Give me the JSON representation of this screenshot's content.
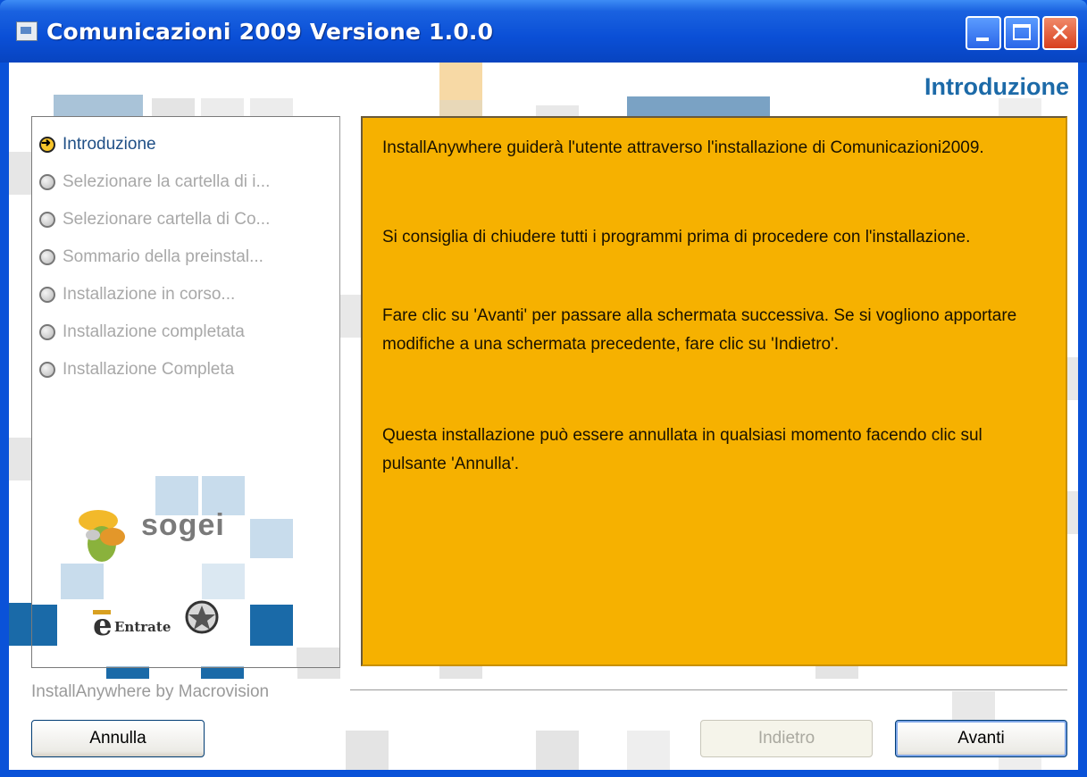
{
  "window": {
    "title": "Comunicazioni 2009 Versione 1.0.0",
    "close_glyph": "✕"
  },
  "header": {
    "title": "Introduzione"
  },
  "steps": [
    {
      "label": "Introduzione",
      "state": "active"
    },
    {
      "label": "Selezionare la cartella di i...",
      "state": "pending"
    },
    {
      "label": "Selezionare cartella di Co...",
      "state": "pending"
    },
    {
      "label": "Sommario della preinstal...",
      "state": "pending"
    },
    {
      "label": "Installazione in corso...",
      "state": "pending"
    },
    {
      "label": "Installazione completata",
      "state": "pending"
    },
    {
      "label": "Installazione Completa",
      "state": "pending"
    }
  ],
  "content": {
    "paragraphs": [
      "InstallAnywhere guiderà l'utente attraverso l'installazione di Comunicazioni2009.",
      "Si consiglia di chiudere tutti i programmi prima di procedere con l'installazione.",
      "Fare clic su 'Avanti' per passare alla schermata successiva. Se si vogliono apportare modifiche a una schermata precedente, fare clic su 'Indietro'.",
      "Questa installazione può essere annullata in qualsiasi momento facendo clic sul pulsante 'Annulla'."
    ]
  },
  "logos": {
    "sogei": "sogei",
    "agenzia": "Entrate"
  },
  "footer": {
    "vendor": "InstallAnywhere by Macrovision",
    "cancel_label": "Annulla",
    "back_label": "Indietro",
    "next_label": "Avanti"
  },
  "colors": {
    "content_bg": "#f6b100",
    "titlebar": "#0a4fd6",
    "accent_blue": "#1c6aa8"
  }
}
